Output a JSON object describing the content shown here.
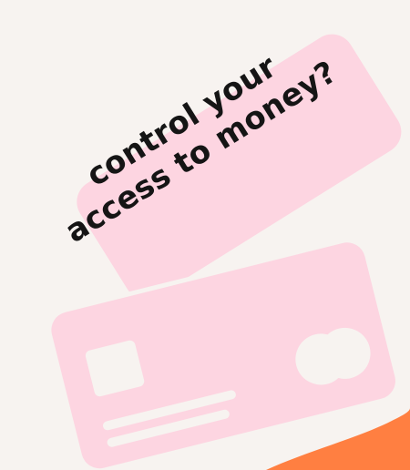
{
  "headline": {
    "line1": "control your",
    "line2": "access to money?"
  },
  "colors": {
    "background": "#f7f3f0",
    "card": "#fdd5e1",
    "card_detail": "#f7f3f0",
    "text": "#151515",
    "accent": "#ff7f41"
  },
  "icons": {
    "cards": "credit-card-icon",
    "chip": "chip-icon",
    "logo": "card-logo-icon"
  }
}
